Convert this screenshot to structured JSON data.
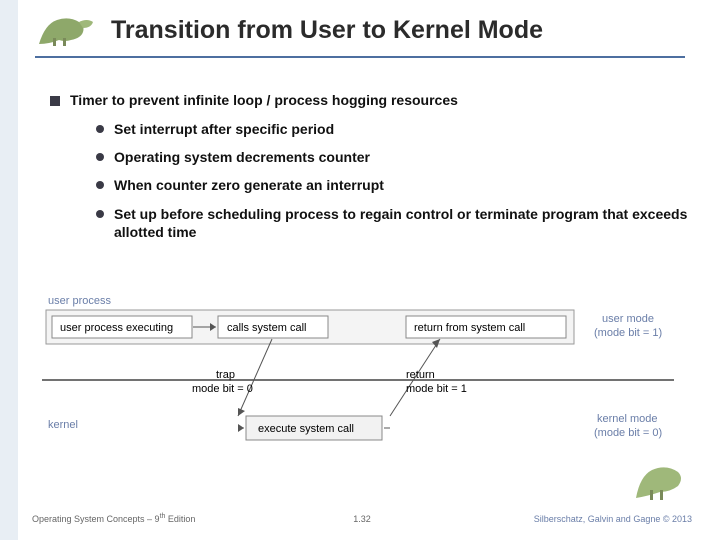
{
  "title": "Transition from User to Kernel Mode",
  "bullets": {
    "main": "Timer to prevent infinite loop / process hogging resources",
    "subs": [
      "Set interrupt after specific period",
      "Operating system decrements counter",
      "When counter zero generate an interrupt",
      "Set up before scheduling process to regain control or terminate program that exceeds allotted time"
    ]
  },
  "diagram": {
    "top_label": "user process",
    "right_top": "user mode",
    "right_top2": "(mode bit = 1)",
    "box1": "user process executing",
    "box2": "calls system call",
    "box3": "return from system call",
    "trap": "trap",
    "trap2": "mode bit = 0",
    "return": "return",
    "return2": "mode bit = 1",
    "kernel": "kernel",
    "right_bot": "kernel mode",
    "right_bot2": "(mode bit = 0)",
    "exec": "execute system call"
  },
  "footer": {
    "left1": "Operating System Concepts – 9",
    "left_sup": "th",
    "left2": " Edition",
    "center": "1.32",
    "right": "Silberschatz, Galvin and Gagne © 2013"
  }
}
